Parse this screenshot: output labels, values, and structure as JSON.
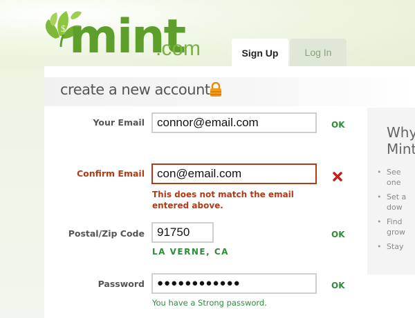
{
  "brand": {
    "name": "mint",
    "suffix": ".com"
  },
  "tabs": [
    {
      "label": "Sign Up",
      "active": true
    },
    {
      "label": "Log In",
      "active": false
    }
  ],
  "page": {
    "title": "create a new account",
    "lock_icon": "lock-icon"
  },
  "form": {
    "email": {
      "label": "Your Email",
      "value": "connor@email.com",
      "status": "OK"
    },
    "confirm_email": {
      "label": "Confirm Email",
      "value": "con@email.com",
      "error": "This does not match the email entered above.",
      "status_icon": "x-icon"
    },
    "zip": {
      "label": "Postal/Zip Code",
      "value": "91750",
      "city": "LA VERNE, CA",
      "status": "OK"
    },
    "password": {
      "label": "Password",
      "value": "●●●●●●●●●●●●",
      "strength": "You have a Strong password.",
      "status": "OK"
    }
  },
  "why": {
    "title": "Why\nMint",
    "items": [
      "See\none",
      "Set a\ndow",
      "Find\ngrow",
      "Stay"
    ]
  },
  "colors": {
    "brand_green": "#5e9e2a",
    "ok_green": "#2e8c3b",
    "error_red": "#b33a14"
  }
}
